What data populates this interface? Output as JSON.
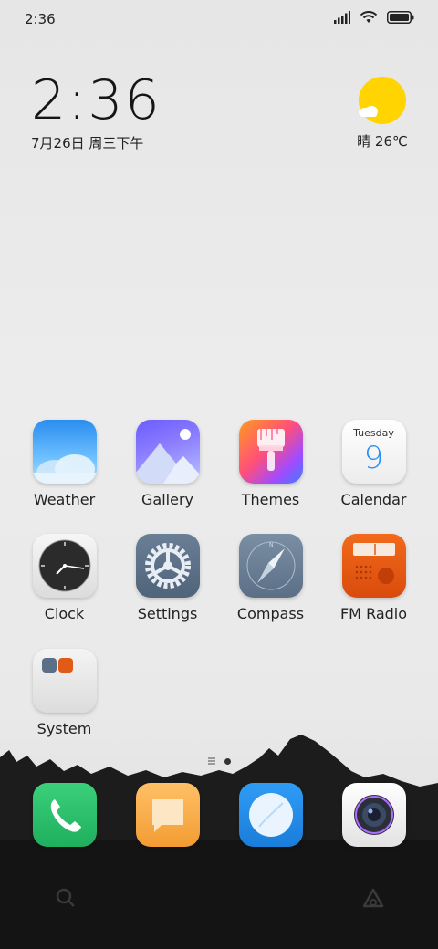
{
  "status_bar": {
    "time": "2:36"
  },
  "clock_widget": {
    "time": "2:36",
    "date": "7月26日 周三下午"
  },
  "weather_widget": {
    "condition": "晴",
    "temperature": "26℃"
  },
  "apps": [
    {
      "label": "Weather"
    },
    {
      "label": "Gallery"
    },
    {
      "label": "Themes"
    },
    {
      "label": "Calendar",
      "weekday": "Tuesday",
      "day": "9"
    },
    {
      "label": "Clock"
    },
    {
      "label": "Settings"
    },
    {
      "label": "Compass"
    },
    {
      "label": "FM Radio"
    },
    {
      "label": "System"
    }
  ],
  "page_indicator": {
    "pages": 2,
    "current": 2
  },
  "dock": [
    "phone-icon",
    "messages-icon",
    "browser-icon",
    "camera-icon"
  ],
  "bottom_bar": [
    "search-icon",
    "assistant-icon"
  ]
}
